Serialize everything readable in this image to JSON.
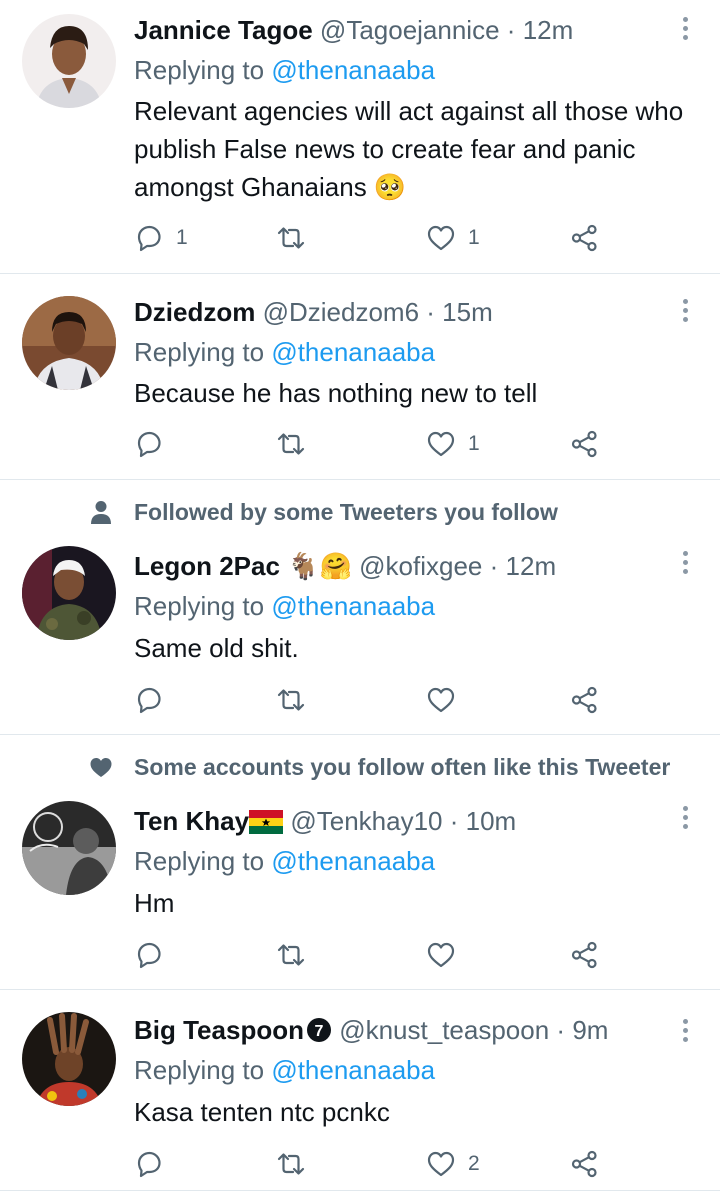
{
  "tweets": [
    {
      "name": "Jannice Tagoe",
      "handle": "@Tagoejannice",
      "dot": "·",
      "time": "12m",
      "replying_prefix": "Replying to",
      "replying_to": "@thenanaaba",
      "text": "Relevant agencies will act against all those who publish False news to create fear and panic amongst Ghanaians 🥺",
      "reply_count": "1",
      "retweet_count": "",
      "like_count": "1"
    },
    {
      "name": "Dziedzom",
      "handle": "@Dziedzom6",
      "dot": "·",
      "time": "15m",
      "replying_prefix": "Replying to",
      "replying_to": "@thenanaaba",
      "text": "Because he has nothing new to tell",
      "reply_count": "",
      "retweet_count": "",
      "like_count": "1"
    },
    {
      "social_context": "Followed by some Tweeters you follow",
      "social_icon": "person-icon",
      "name": "Legon 2Pac",
      "name_emoji": "🐐🤗",
      "handle": "@kofixgee",
      "dot": "·",
      "time": "12m",
      "replying_prefix": "Replying to",
      "replying_to": "@thenanaaba",
      "text": "Same old shit.",
      "reply_count": "",
      "retweet_count": "",
      "like_count": ""
    },
    {
      "social_context": "Some accounts you follow often like this Tweeter",
      "social_icon": "heart-icon",
      "name": "Ten Khay",
      "name_flag": "ghana-flag",
      "handle": "@Tenkhay10",
      "dot": "·",
      "time": "10m",
      "replying_prefix": "Replying to",
      "replying_to": "@thenanaaba",
      "text": "Hm",
      "reply_count": "",
      "retweet_count": "",
      "like_count": ""
    },
    {
      "name": "Big Teaspoon",
      "name_badge": "7",
      "handle": "@knust_teaspoon",
      "dot": "·",
      "time": "9m",
      "replying_prefix": "Replying to",
      "replying_to": "@thenanaaba",
      "text": "Kasa tenten ntc pcnkc",
      "reply_count": "",
      "retweet_count": "",
      "like_count": "2"
    }
  ],
  "colors": {
    "text": "#0f1419",
    "secondary": "#536471",
    "link": "#1d9bf0",
    "divider": "#e1e8ed"
  }
}
